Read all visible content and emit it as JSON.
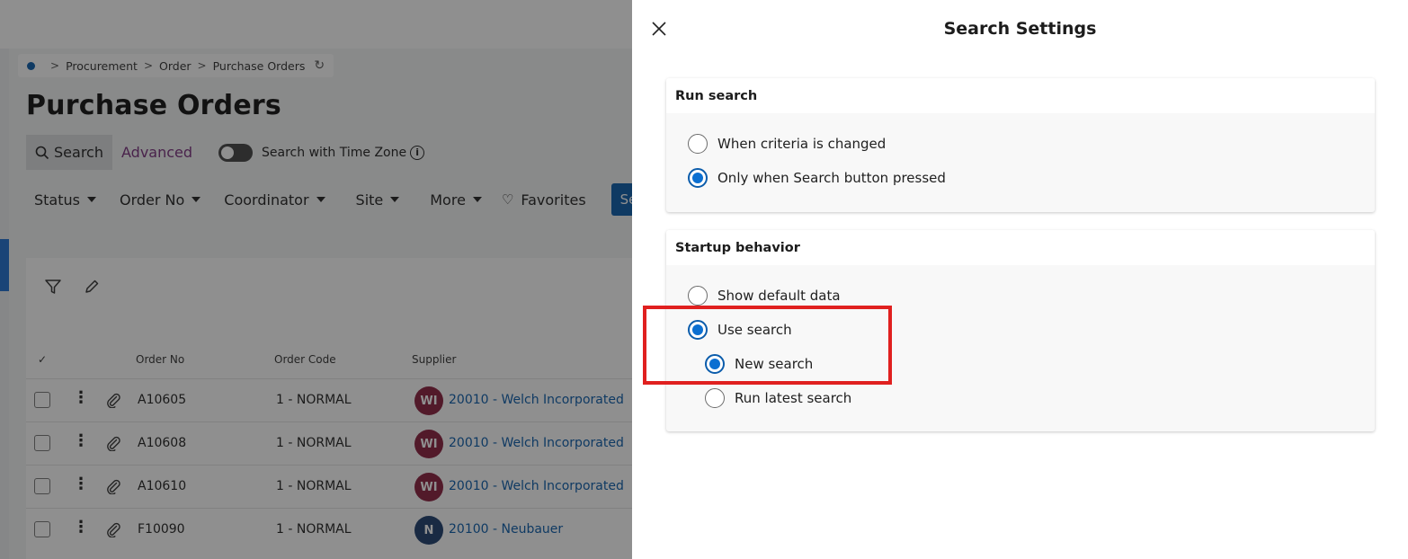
{
  "breadcrumb": {
    "items": [
      "Procurement",
      "Order",
      "Purchase Orders"
    ]
  },
  "page": {
    "title": "Purchase Orders"
  },
  "search_bar": {
    "search_label": "Search",
    "advanced_label": "Advanced",
    "timezone_label": "Search with Time Zone"
  },
  "filters": {
    "status": "Status",
    "order_no": "Order No",
    "coordinator": "Coordinator",
    "site": "Site",
    "more": "More",
    "favorites": "Favorites",
    "search_button": "Searc"
  },
  "grid": {
    "columns": [
      "Order No",
      "Order Code",
      "Supplier"
    ],
    "rows": [
      {
        "order_no": "A10605",
        "order_code": "1 - NORMAL",
        "avatar": "WI",
        "avatar_color": "#8b1f3f",
        "supplier": "20010 - Welch Incorporated"
      },
      {
        "order_no": "A10608",
        "order_code": "1 - NORMAL",
        "avatar": "WI",
        "avatar_color": "#8b1f3f",
        "supplier": "20010 - Welch Incorporated"
      },
      {
        "order_no": "A10610",
        "order_code": "1 - NORMAL",
        "avatar": "WI",
        "avatar_color": "#8b1f3f",
        "supplier": "20010 - Welch Incorporated"
      },
      {
        "order_no": "F10090",
        "order_code": "1 - NORMAL",
        "avatar": "N",
        "avatar_color": "#1d3e6e",
        "supplier": "20100 - Neubauer"
      }
    ]
  },
  "dialog": {
    "title": "Search Settings",
    "run_search": {
      "heading": "Run search",
      "options": [
        "When criteria is changed",
        "Only when Search button pressed"
      ],
      "selected": "Only when Search button pressed"
    },
    "startup_behavior": {
      "heading": "Startup behavior",
      "options": [
        "Show default data",
        "Use search"
      ],
      "selected": "Use search",
      "sub_options": [
        "New search",
        "Run latest search"
      ],
      "sub_selected": "New search"
    }
  },
  "colors": {
    "primary": "#0b5cab",
    "radio_fill": "#0b6fd1",
    "highlight": "#e0201f",
    "advanced": "#7a2f7e"
  }
}
